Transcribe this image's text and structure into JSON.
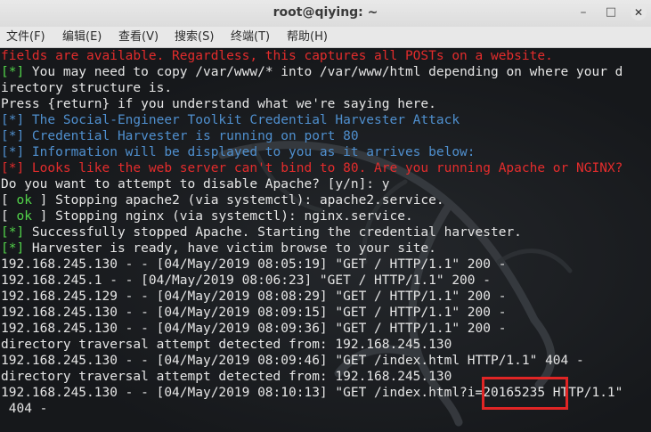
{
  "window": {
    "title": "root@qiying: ~",
    "controls": {
      "minimize": "–",
      "maximize": "□",
      "close": "✕"
    }
  },
  "menu": [
    "文件(F)",
    "编辑(E)",
    "查看(V)",
    "搜索(S)",
    "终端(T)",
    "帮助(H)"
  ],
  "terminal": {
    "lines": {
      "l0": "fields are available. Regardless, this captures all POSTs on a website.",
      "l1_tag": "[*]",
      "l1_text": " You may need to copy /var/www/* into /var/www/html depending on where your d",
      "l2": "irectory structure is.",
      "l3": "Press {return} if you understand what we're saying here.",
      "l4": "[*] The Social-Engineer Toolkit Credential Harvester Attack",
      "l5": "[*] Credential Harvester is running on port 80",
      "l6": "[*] Information will be displayed to you as it arrives below:",
      "l7": "[*] Looks like the web server can't bind to 80. Are you running Apache or NGINX?",
      "l8": "Do you want to attempt to disable Apache? [y/n]: y",
      "l9_open": "[ ",
      "l9_ok": "ok",
      "l9_text": " ] Stopping apache2 (via systemctl): apache2.service.",
      "l10_open": "[ ",
      "l10_ok": "ok",
      "l10_text": " ] Stopping nginx (via systemctl): nginx.service.",
      "l11_tag": "[*]",
      "l11_text": " Successfully stopped Apache. Starting the credential harvester.",
      "l12_tag": "[*]",
      "l12_text": " Harvester is ready, have victim browse to your site.",
      "l13": "192.168.245.130 - - [04/May/2019 08:05:19] \"GET / HTTP/1.1\" 200 -",
      "l14": "192.168.245.1 - - [04/May/2019 08:06:23] \"GET / HTTP/1.1\" 200 -",
      "l15": "192.168.245.129 - - [04/May/2019 08:08:29] \"GET / HTTP/1.1\" 200 -",
      "l16": "192.168.245.130 - - [04/May/2019 08:09:15] \"GET / HTTP/1.1\" 200 -",
      "l17": "192.168.245.130 - - [04/May/2019 08:09:36] \"GET / HTTP/1.1\" 200 -",
      "l18": "directory traversal attempt detected from: 192.168.245.130",
      "l19": "192.168.245.130 - - [04/May/2019 08:09:46] \"GET /index.html HTTP/1.1\" 404 -",
      "l20": "directory traversal attempt detected from: 192.168.245.130",
      "l21": "192.168.245.130 - - [04/May/2019 08:10:13] \"GET /index.html?i=20165235 HTTP/1.1\"",
      "l22": " 404 -"
    }
  },
  "colors": {
    "error_red": "#e32c2c",
    "info_blue": "#4f8fce",
    "success_green": "#52d34a",
    "highlight_box": "#e02525"
  },
  "icons": {
    "background": "kali-dragon-icon"
  }
}
